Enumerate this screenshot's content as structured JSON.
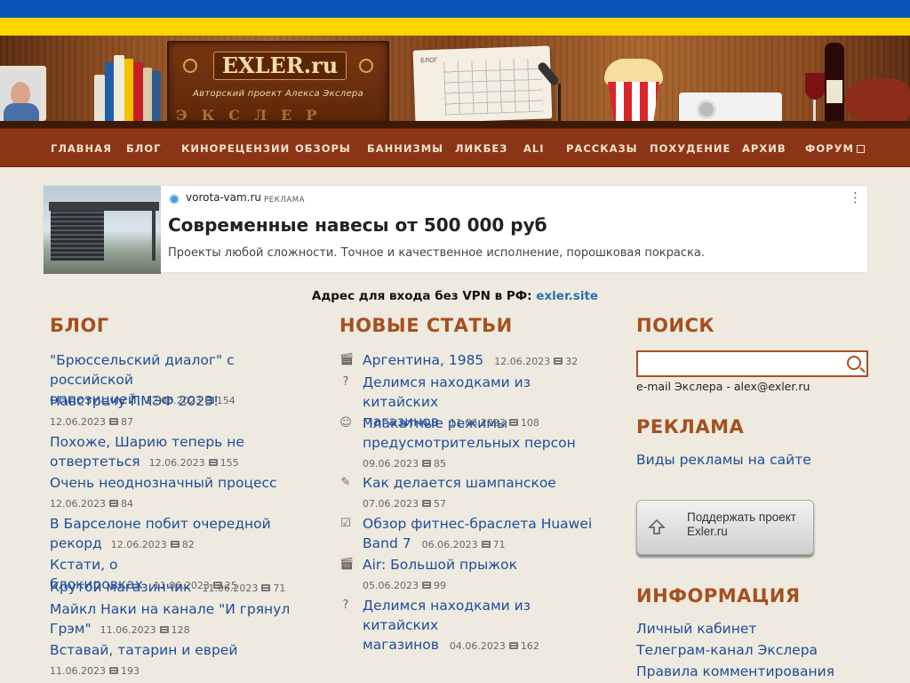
{
  "header": {
    "logo_title": "EXLER.ru",
    "logo_subtitle": "Авторский проект Алекса Экслера",
    "calendar_label": "БЛОГ"
  },
  "nav": {
    "items": [
      {
        "label": "ГЛАВНАЯ"
      },
      {
        "label": "БЛОГ"
      },
      {
        "label": "КИНОРЕЦЕНЗИИ"
      },
      {
        "label": "ОБЗОРЫ"
      },
      {
        "label": "БАННИЗМЫ"
      },
      {
        "label": "ЛИКБЕЗ"
      },
      {
        "label": "ALI"
      },
      {
        "label": "РАССКАЗЫ"
      },
      {
        "label": "ПОХУДЕНИЕ"
      },
      {
        "label": "АРХИВ"
      },
      {
        "label": "ФОРУМ"
      }
    ]
  },
  "ad": {
    "domain": "vorota-vam.ru",
    "label": "РЕКЛАМА",
    "title": "Современные навесы от 500 000 руб",
    "text": "Проекты любой сложности. Точное и качественное исполнение, порошковая покраска."
  },
  "vpn": {
    "text": "Адрес для входа без VPN в РФ:",
    "link": "exler.site"
  },
  "blog": {
    "heading": "БЛОГ",
    "posts": [
      {
        "title": "\"Брюссельский диалог\" с российской оппозицией",
        "date": "12.06.2023",
        "comments": "154"
      },
      {
        "title": "Навстречу ПМЭФ 2023!",
        "date": "12.06.2023",
        "comments": "87"
      },
      {
        "title": "Похоже, Шарию теперь не отвертеться",
        "date": "12.06.2023",
        "comments": "155"
      },
      {
        "title": "Очень неоднозначный процесс",
        "date": "12.06.2023",
        "comments": "84"
      },
      {
        "title": "В Барселоне побит очередной рекорд",
        "date": "12.06.2023",
        "comments": "82"
      },
      {
        "title": "Кстати, о блокировках",
        "date": "11.06.2023",
        "comments": "25"
      },
      {
        "title": "Крутой магазинчик",
        "date": "11.06.2023",
        "comments": "71"
      },
      {
        "title": "Майкл Наки на канале \"И грянул Грэм\"",
        "date": "11.06.2023",
        "comments": "128"
      },
      {
        "title": "Вставай, татарин и еврей",
        "date": "11.06.2023",
        "comments": "193"
      }
    ]
  },
  "articles": {
    "heading": "НОВЫЕ СТАТЬИ",
    "items": [
      {
        "icon": "film-icon",
        "title": "Аргентина, 1985",
        "date": "12.06.2023",
        "comments": "32"
      },
      {
        "icon": "question-icon",
        "title": "Делимся находками из китайских магазинов",
        "date": "11.06.2023",
        "comments": "108"
      },
      {
        "icon": "smile-icon",
        "title": "Плакатные режимы предусмотрительных персон",
        "date": "09.06.2023",
        "comments": "85"
      },
      {
        "icon": "pencil-icon",
        "title": "Как делается шампанское",
        "date": "07.06.2023",
        "comments": "57"
      },
      {
        "icon": "clipboard-icon",
        "title": "Обзор фитнес-браслета Huawei Band 7",
        "date": "06.06.2023",
        "comments": "71"
      },
      {
        "icon": "film-icon",
        "title": "Air: Большой прыжок",
        "date": "05.06.2023",
        "comments": "99"
      },
      {
        "icon": "question-icon",
        "title": "Делимся находками из китайских магазинов",
        "date": "04.06.2023",
        "comments": "162"
      }
    ]
  },
  "sidebar": {
    "search_heading": "ПОИСК",
    "search_placeholder": "",
    "email_line": "e-mail Экслера - alex@exler.ru",
    "ads_heading": "РЕКЛАМА",
    "ads_link": "Виды рекламы на сайте",
    "support_label": "Поддержать проект Exler.ru",
    "info_heading": "ИНФОРМАЦИЯ",
    "info_links": [
      {
        "label": "Личный кабинет"
      },
      {
        "label": "Телеграм-канал Экслера"
      },
      {
        "label": "Правила комментирования"
      }
    ]
  },
  "colors": {
    "accent": "#a5501f",
    "link": "#1e4c9a",
    "nav_bg": "#8c3516",
    "flag_blue": "#0a56b8",
    "flag_yellow": "#ffd500"
  }
}
